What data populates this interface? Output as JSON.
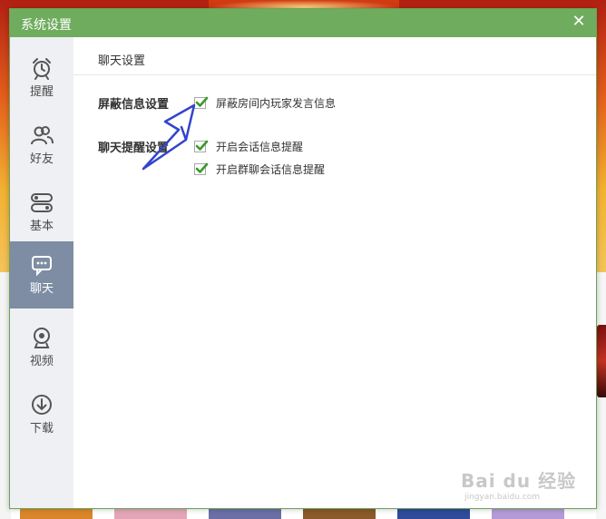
{
  "dialog": {
    "title": "系统设置",
    "close_symbol": "✕"
  },
  "sidebar": {
    "items": [
      {
        "label": "提醒",
        "icon": "alarm-clock-icon",
        "active": false
      },
      {
        "label": "好友",
        "icon": "friends-icon",
        "active": false
      },
      {
        "label": "基本",
        "icon": "toggle-settings-icon",
        "active": false
      },
      {
        "label": "聊天",
        "icon": "chat-bubble-icon",
        "active": true
      },
      {
        "label": "视频",
        "icon": "webcam-icon",
        "active": false
      },
      {
        "label": "下载",
        "icon": "download-icon",
        "active": false
      }
    ]
  },
  "content": {
    "header": "聊天设置",
    "sections": [
      {
        "label": "屏蔽信息设置",
        "options": [
          {
            "text": "屏蔽房间内玩家发言信息",
            "checked": true
          }
        ]
      },
      {
        "label": "聊天提醒设置",
        "options": [
          {
            "text": "开启会话信息提醒",
            "checked": true
          },
          {
            "text": "开启群聊会话信息提醒",
            "checked": true
          }
        ]
      }
    ]
  },
  "watermark": {
    "main": "Bai du 经验",
    "sub": "jingyan.baidu.com"
  },
  "colors": {
    "titlebar": "#6fac5e",
    "sidebar_bg": "#eef0f3",
    "sidebar_active": "#7e8da3",
    "check_green": "#3a9a2a",
    "annotation_arrow": "#3344cc"
  }
}
